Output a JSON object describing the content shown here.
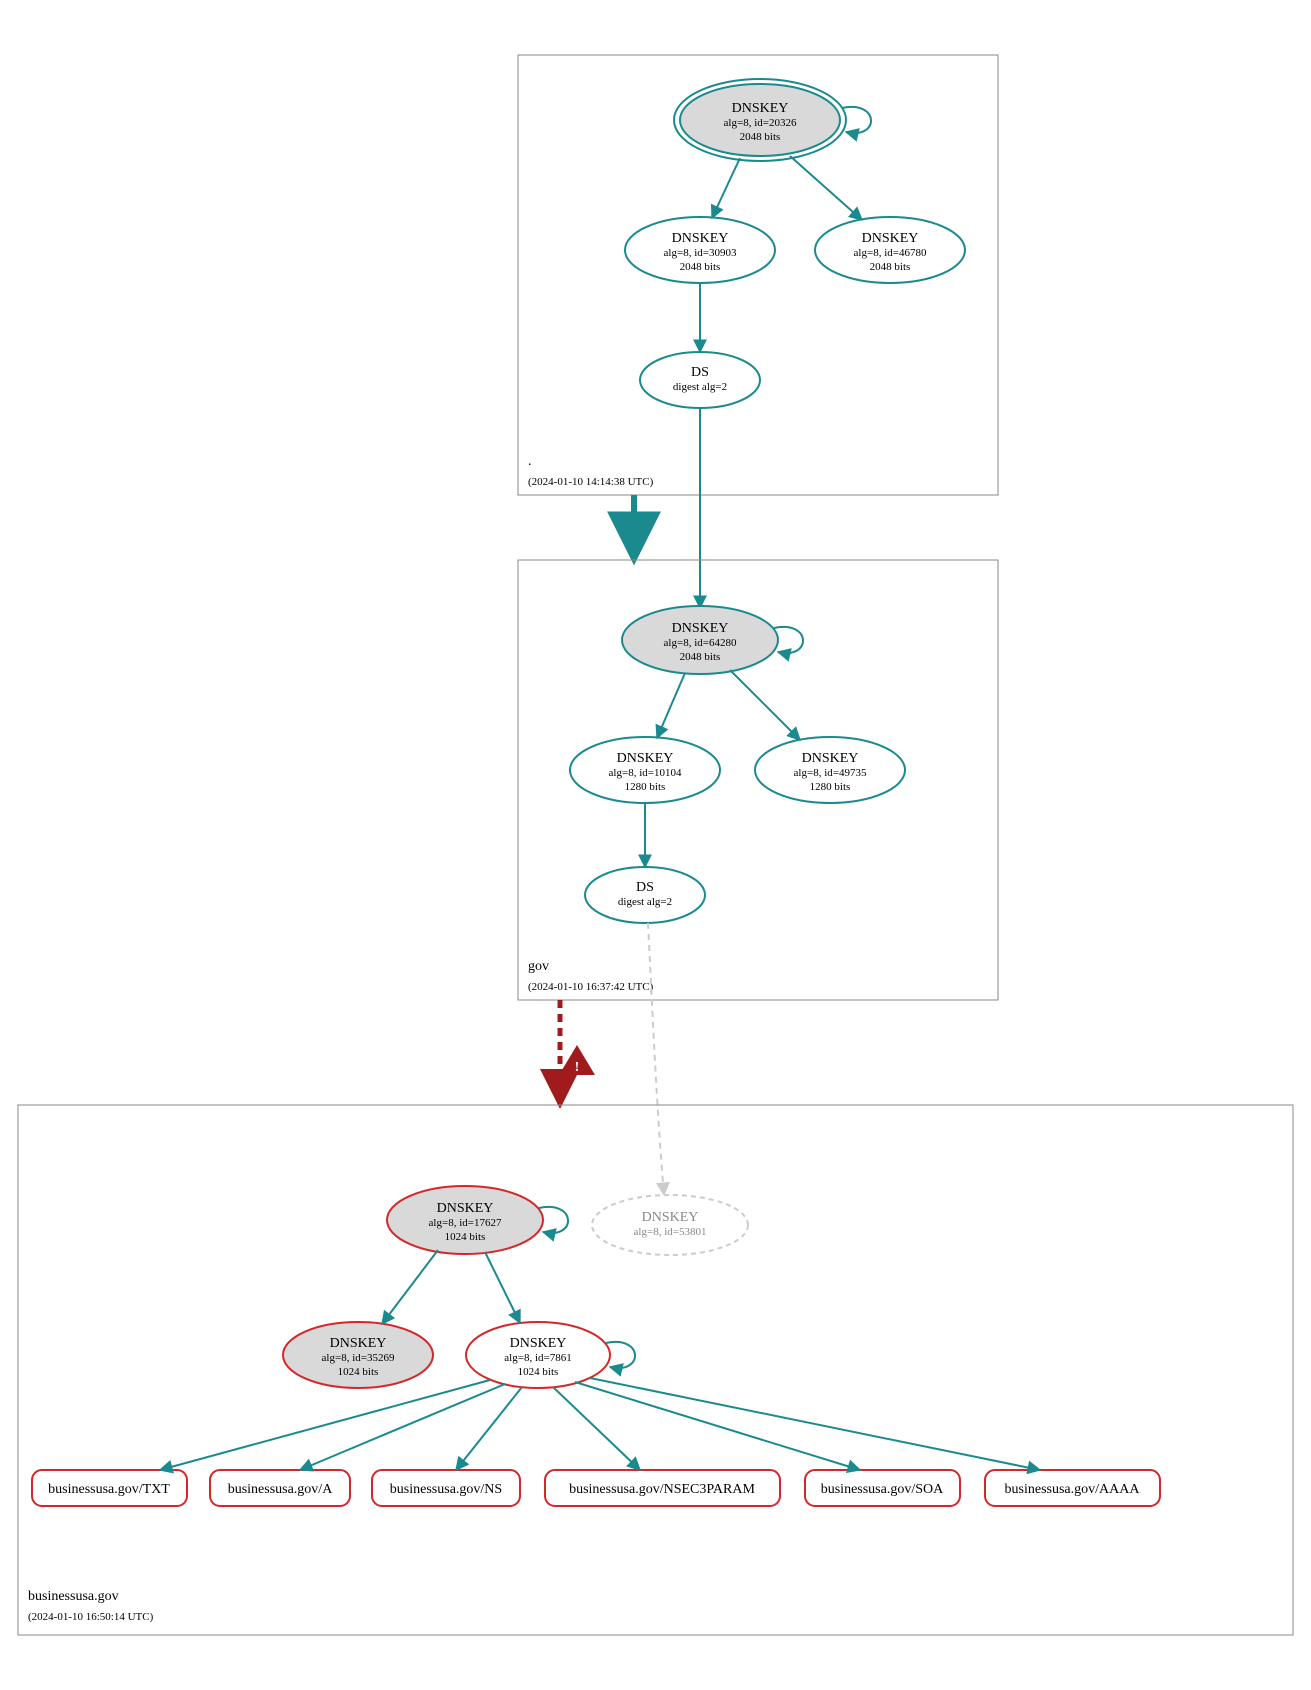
{
  "zones": {
    "root": {
      "name": ".",
      "timestamp": "(2024-01-10 14:14:38 UTC)",
      "nodes": {
        "ksk": {
          "title": "DNSKEY",
          "line1": "alg=8, id=20326",
          "line2": "2048 bits"
        },
        "zsk1": {
          "title": "DNSKEY",
          "line1": "alg=8, id=30903",
          "line2": "2048 bits"
        },
        "zsk2": {
          "title": "DNSKEY",
          "line1": "alg=8, id=46780",
          "line2": "2048 bits"
        },
        "ds": {
          "title": "DS",
          "line1": "digest alg=2"
        }
      }
    },
    "gov": {
      "name": "gov",
      "timestamp": "(2024-01-10 16:37:42 UTC)",
      "nodes": {
        "ksk": {
          "title": "DNSKEY",
          "line1": "alg=8, id=64280",
          "line2": "2048 bits"
        },
        "zsk1": {
          "title": "DNSKEY",
          "line1": "alg=8, id=10104",
          "line2": "1280 bits"
        },
        "zsk2": {
          "title": "DNSKEY",
          "line1": "alg=8, id=49735",
          "line2": "1280 bits"
        },
        "ds": {
          "title": "DS",
          "line1": "digest alg=2"
        }
      }
    },
    "businessusa": {
      "name": "businessusa.gov",
      "timestamp": "(2024-01-10 16:50:14 UTC)",
      "nodes": {
        "ksk": {
          "title": "DNSKEY",
          "line1": "alg=8, id=17627",
          "line2": "1024 bits"
        },
        "missing": {
          "title": "DNSKEY",
          "line1": "alg=8, id=53801"
        },
        "k2": {
          "title": "DNSKEY",
          "line1": "alg=8, id=35269",
          "line2": "1024 bits"
        },
        "zsk": {
          "title": "DNSKEY",
          "line1": "alg=8, id=7861",
          "line2": "1024 bits"
        }
      },
      "rrsets": {
        "txt": "businessusa.gov/TXT",
        "a": "businessusa.gov/A",
        "ns": "businessusa.gov/NS",
        "nsec3param": "businessusa.gov/NSEC3PARAM",
        "soa": "businessusa.gov/SOA",
        "aaaa": "businessusa.gov/AAAA"
      }
    }
  },
  "colors": {
    "teal": "#1b8a8f",
    "red": "#d62728",
    "darkred": "#a01c1c",
    "gray": "#cccccc",
    "greyfill": "#d9d9d9",
    "black": "#000000"
  }
}
